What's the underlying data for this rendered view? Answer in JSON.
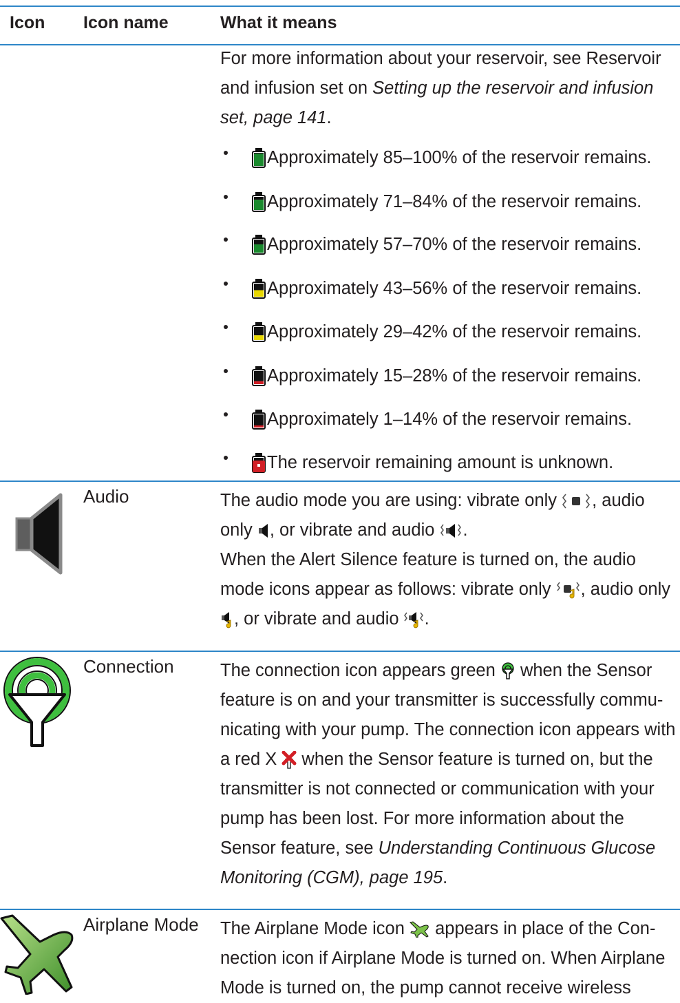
{
  "header": {
    "col_icon": "Icon",
    "col_name": "Icon name",
    "col_meaning": "What it means"
  },
  "reservoir_row": {
    "intro_1": "For more information about your reservoir, see Reservoir and infusion set on ",
    "intro_link": "Setting up the reservoir and infusion set, page 141",
    "intro_2": ".",
    "levels": [
      {
        "text": "Approximately 85–100% of the reservoir remains.",
        "fill_fraction": 0.93,
        "color": "#1a8a2e"
      },
      {
        "text": "Approximately 71–84% of the reservoir remains.",
        "fill_fraction": 0.78,
        "color": "#1a8a2e"
      },
      {
        "text": "Approximately 57–70% of the reservoir remains.",
        "fill_fraction": 0.63,
        "color": "#1a8a2e"
      },
      {
        "text": "Approximately 43–56% of the reservoir remains.",
        "fill_fraction": 0.5,
        "color": "#e8d800"
      },
      {
        "text": "Approximately 29–42% of the reservoir remains.",
        "fill_fraction": 0.36,
        "color": "#e8d800"
      },
      {
        "text": "Approximately 15–28% of the reservoir remains.",
        "fill_fraction": 0.22,
        "color": "#d21f26"
      },
      {
        "text": "Approximately 1–14% of the reservoir remains.",
        "fill_fraction": 0.08,
        "color": "#d21f26"
      },
      {
        "text": " The reservoir remaining amount is unknown.",
        "fill_fraction": 0.0,
        "color": "#d21f26"
      }
    ]
  },
  "audio_row": {
    "icon": "speaker-icon",
    "name": "Audio",
    "p1_a": "The audio mode you are using: vibrate only ",
    "p1_b": ", audio only ",
    "p1_c": ", or vibrate and audio ",
    "p1_d": ".",
    "p2_a": "When the Alert Silence feature is turned on, the audio mode icons appear as follows: vibrate only ",
    "p2_b": ", audio only ",
    "p2_c": ", or vibrate and audio ",
    "p2_d": "."
  },
  "connection_row": {
    "icon": "connection-antenna-icon",
    "name": "Connection",
    "t1": "The connection icon appears green ",
    "t2": " when the Sensor feature is on and your transmitter is successfully commu-nicating with your pump. The connection icon appears with a red X ",
    "t3": " when the Sensor feature is turned on, but the transmitter is not connected or communication with your pump has been lost. For more information about the Sensor feature, see ",
    "t_link": "Understanding Continuous Glucose Monitoring (CGM), page 195",
    "t4": "."
  },
  "airplane_row": {
    "icon": "airplane-icon",
    "name": "Airplane Mode",
    "t1": "The Airplane Mode icon ",
    "t2": " appears in place of the Con-nection icon if Airplane Mode is turned on. When Airplane Mode is turned on, the pump cannot receive wireless"
  },
  "colors": {
    "rule": "#2e86c8",
    "green": "#1a8a2e",
    "bright_green": "#3fbf3f",
    "yellow": "#e8d800",
    "red": "#d21f26"
  }
}
